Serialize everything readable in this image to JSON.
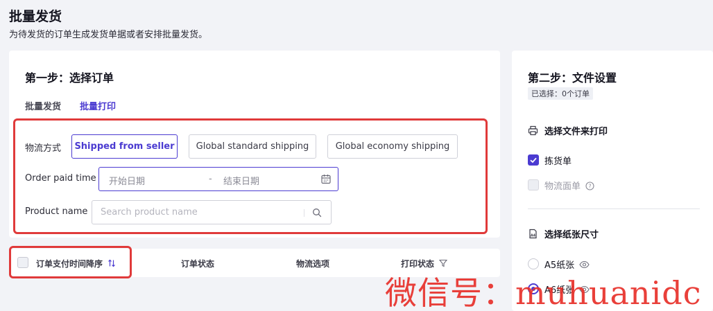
{
  "page": {
    "title": "批量发货",
    "subtitle": "为待发货的订单生成发货单据或者安排批量发货。"
  },
  "step1": {
    "title": "第一步：选择订单",
    "tabs": [
      {
        "label": "批量发货",
        "active": false
      },
      {
        "label": "批量打印",
        "active": true
      }
    ],
    "shipping_method": {
      "label": "物流方式",
      "options": [
        "Shipped from seller",
        "Global standard shipping",
        "Global economy shipping"
      ],
      "selected": "Shipped from seller"
    },
    "order_paid_time": {
      "label": "Order paid time",
      "start_placeholder": "开始日期",
      "separator": "-",
      "end_placeholder": "结束日期"
    },
    "product_name": {
      "label": "Product name",
      "placeholder": "Search product name"
    },
    "table_columns": [
      "订单支付时间降序",
      "订单状态",
      "物流选项",
      "打印状态"
    ]
  },
  "step2": {
    "title": "第二步：文件设置",
    "selected_badge": "已选择：0个订单",
    "print_section": {
      "label": "选择文件来打印",
      "options": [
        {
          "label": "拣货单",
          "checked": true,
          "disabled": false
        },
        {
          "label": "物流面单",
          "checked": false,
          "disabled": true
        }
      ]
    },
    "paper_section": {
      "label": "选择纸张尺寸",
      "options": [
        {
          "label": "A5纸张",
          "selected": false
        },
        {
          "label": "A6纸张",
          "selected": true
        }
      ]
    }
  },
  "watermark": "微信号：muhuanidc",
  "colors": {
    "accent": "#4b3bd1",
    "highlight_box": "#e03a3a",
    "watermark": "#e8302a"
  }
}
